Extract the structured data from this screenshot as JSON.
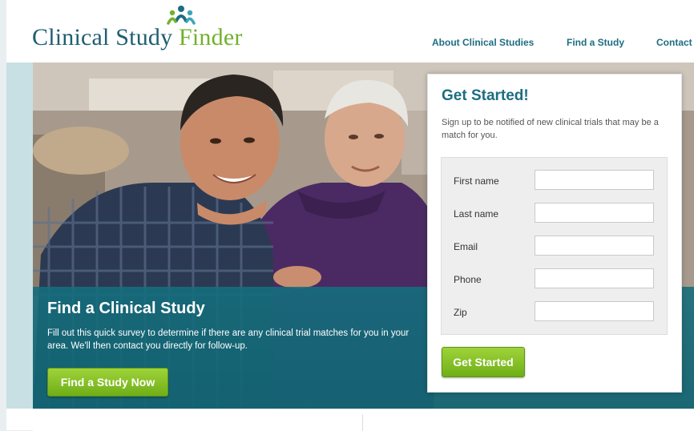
{
  "header": {
    "logo_part1": "Clinical Study ",
    "logo_part2": "Finder",
    "logo_icon": "people-group-icon",
    "nav": [
      "About Clinical Studies",
      "Find a Study",
      "Contact"
    ]
  },
  "hero": {
    "title": "Find a Clinical Study",
    "description": "Fill out this quick survey to determine if there are any clinical trial matches for you in your area. We'll then contact you directly for follow-up.",
    "button_label": "Find a Study Now"
  },
  "signup": {
    "title": "Get Started!",
    "description": "Sign up to be notified of new clinical trials that may be a match for you.",
    "fields": [
      {
        "label": "First name",
        "value": ""
      },
      {
        "label": "Last name",
        "value": ""
      },
      {
        "label": "Email",
        "value": ""
      },
      {
        "label": "Phone",
        "value": ""
      },
      {
        "label": "Zip",
        "value": ""
      }
    ],
    "button_label": "Get Started"
  },
  "colors": {
    "brand_teal": "#1d6d82",
    "brand_green": "#71b22c",
    "hero_overlay": "#14707d"
  }
}
